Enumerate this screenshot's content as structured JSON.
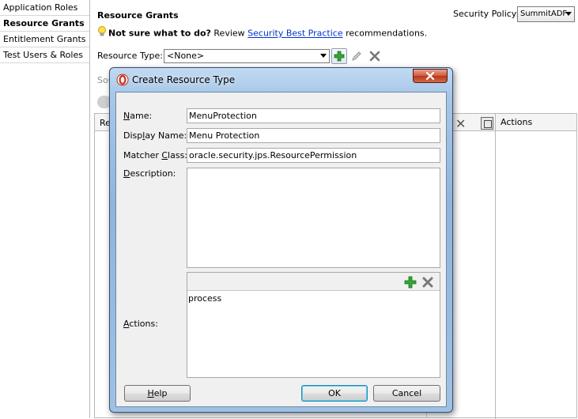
{
  "sidebar": {
    "items": [
      {
        "label": "Application Roles",
        "active": false
      },
      {
        "label": "Resource Grants",
        "active": true
      },
      {
        "label": "Entitlement Grants",
        "active": false
      },
      {
        "label": "Test Users & Roles",
        "active": false
      }
    ]
  },
  "main": {
    "title": "Resource Grants",
    "hint": {
      "bold": "Not sure what to do?",
      "pre": " Review ",
      "link": "Security Best Practice",
      "post": " recommendations."
    },
    "security_policy_label": "Security Policy:",
    "security_policy_value": "SummitADF",
    "resource_type_label": "Resource Type:",
    "resource_type_value": "<None>",
    "partial_source_label": "Sou",
    "partial_col_label": "Re",
    "actions_header": "Actions"
  },
  "dialog": {
    "title": "Create Resource Type",
    "name_label": {
      "pre": "",
      "u": "N",
      "post": "ame:"
    },
    "display_name_label": {
      "pre": "Disp",
      "u": "l",
      "post": "ay Name:"
    },
    "matcher_class_label": {
      "pre": "Matcher ",
      "u": "C",
      "post": "lass:"
    },
    "description_label": {
      "pre": "",
      "u": "D",
      "post": "escription:"
    },
    "actions_label": {
      "pre": "",
      "u": "A",
      "post": "ctions:"
    },
    "name_value": "MenuProtection",
    "display_name_value": "Menu Protection",
    "matcher_class_value": "oracle.security.jps.ResourcePermission",
    "description_value": "",
    "actions_list": [
      "process"
    ],
    "help_button": {
      "pre": "",
      "u": "H",
      "post": "elp"
    },
    "ok_button": "OK",
    "cancel_button": "Cancel"
  },
  "colors": {
    "accent_green": "#2a9a2a",
    "link_blue": "#0033cc",
    "dialog_frame": "#a7c7e8"
  }
}
